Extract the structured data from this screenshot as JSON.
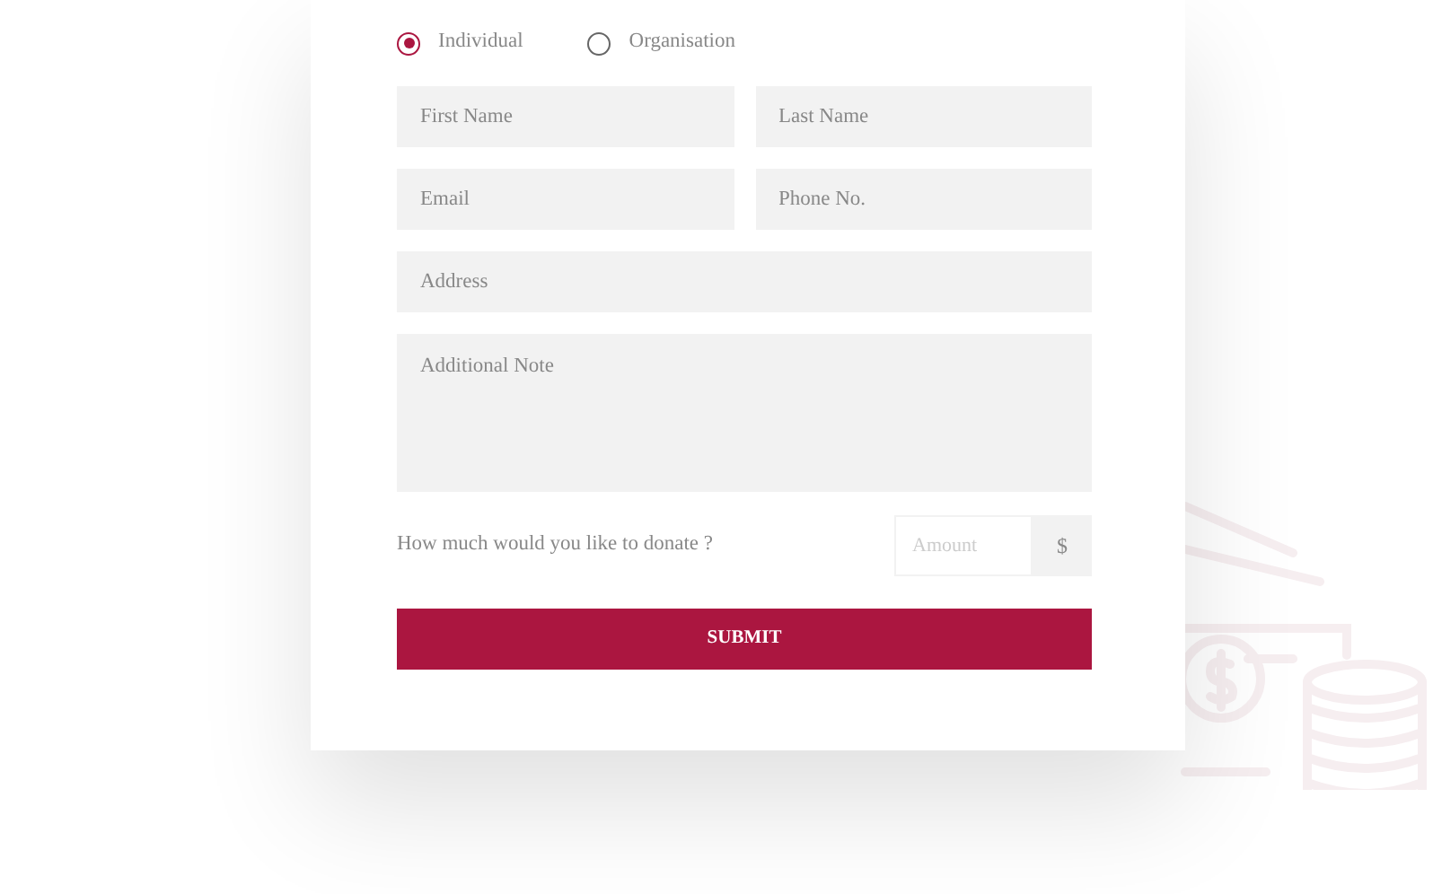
{
  "donor_type": [
    {
      "label": "Individual",
      "selected": true
    },
    {
      "label": "Organisation",
      "selected": false
    }
  ],
  "fields": [
    {
      "kind": "half",
      "placeholder": "First Name"
    },
    {
      "kind": "half",
      "placeholder": "Last Name"
    },
    {
      "kind": "half",
      "placeholder": "Email"
    },
    {
      "kind": "half",
      "placeholder": "Phone No."
    },
    {
      "kind": "full",
      "placeholder": "Address"
    },
    {
      "kind": "textarea",
      "placeholder": "Additional Note"
    }
  ],
  "donation": {
    "question": "How much would you like to donate ?",
    "amount_placeholder": "Amount",
    "currency": "$"
  },
  "submit_button": "SUBMIT"
}
